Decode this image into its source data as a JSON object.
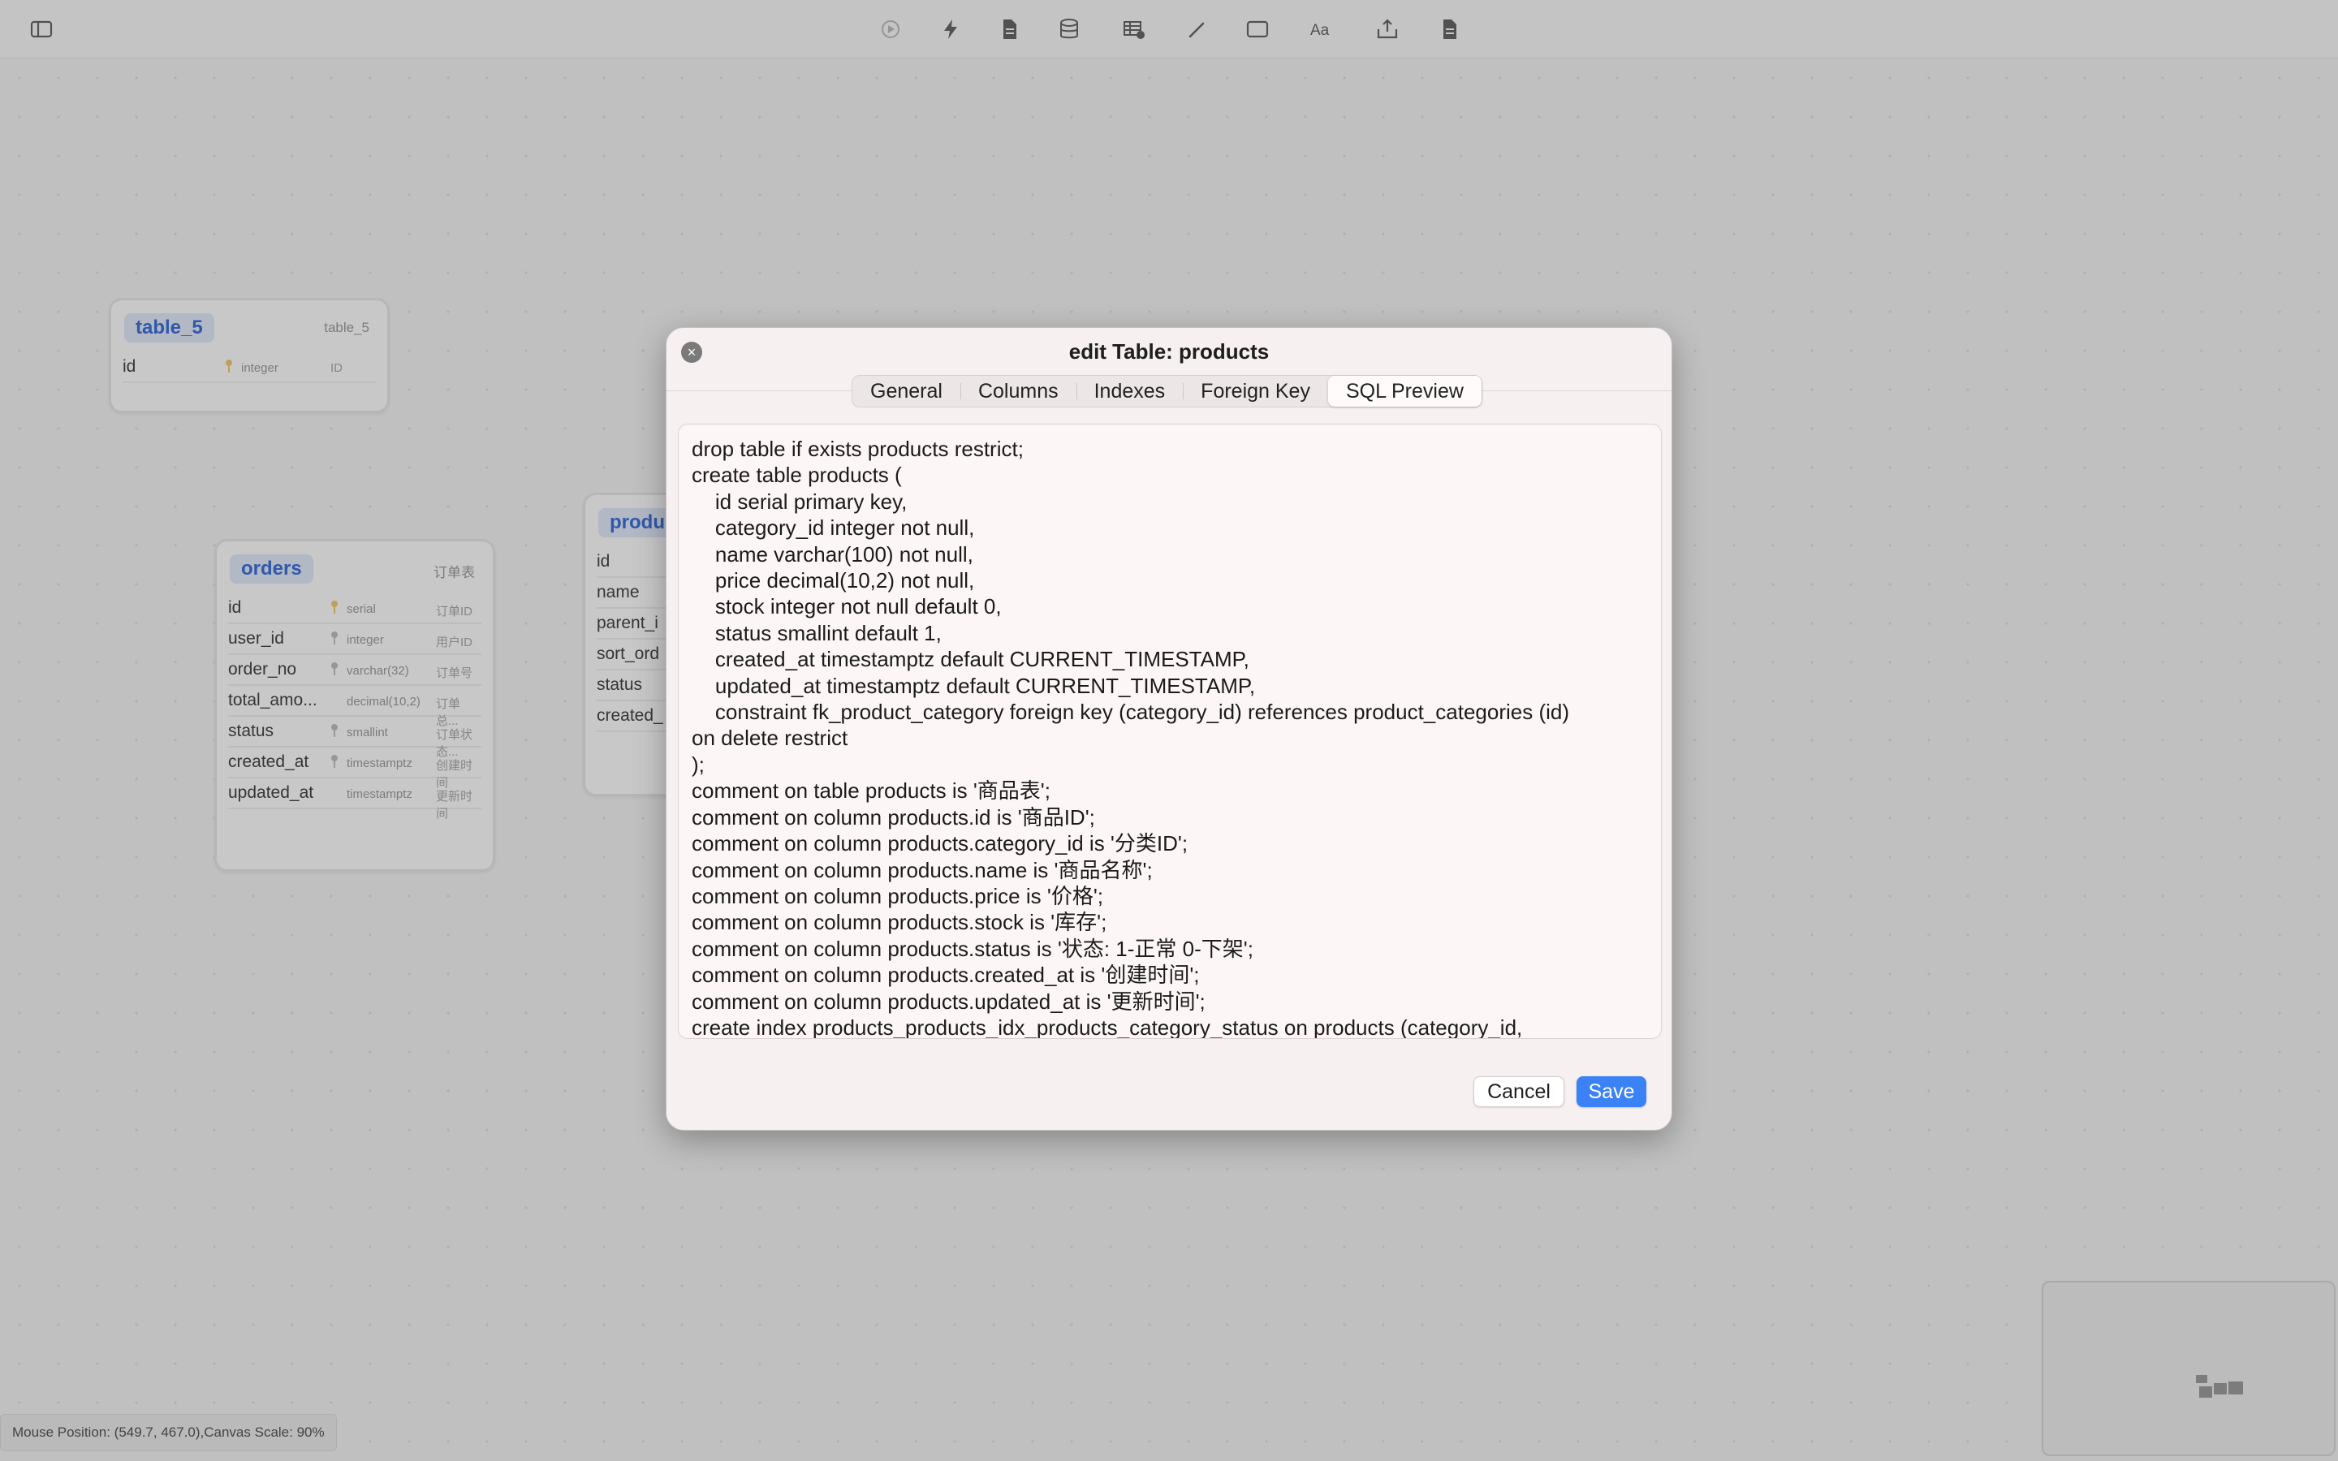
{
  "window": {
    "dialog_title": "edit Table: products"
  },
  "toolbar": {
    "icons": [
      "sidebar-toggle-icon",
      "play-icon",
      "lightning-icon",
      "document-icon",
      "database-icon",
      "table-add-icon",
      "pencil-icon",
      "rectangle-icon",
      "text-format-icon",
      "export-icon",
      "file-icon"
    ]
  },
  "tables": {
    "table_5": {
      "name": "table_5",
      "comment": "table_5",
      "columns": [
        {
          "name": "id",
          "type": "integer",
          "comment": "ID"
        }
      ]
    },
    "orders": {
      "name": "orders",
      "comment": "订单表",
      "columns": [
        {
          "name": "id",
          "type": "serial",
          "comment": "订单ID"
        },
        {
          "name": "user_id",
          "type": "integer",
          "comment": "用户ID"
        },
        {
          "name": "order_no",
          "type": "varchar(32)",
          "comment": "订单号"
        },
        {
          "name": "total_amo...",
          "type": "decimal(10,2)",
          "comment": "订单总..."
        },
        {
          "name": "status",
          "type": "smallint",
          "comment": "订单状态..."
        },
        {
          "name": "created_at",
          "type": "timestamptz",
          "comment": "创建时间"
        },
        {
          "name": "updated_at",
          "type": "timestamptz",
          "comment": "更新时间"
        }
      ]
    },
    "products": {
      "name": "produ",
      "columns": [
        {
          "name": "id"
        },
        {
          "name": "name"
        },
        {
          "name": "parent_i"
        },
        {
          "name": "sort_ord"
        },
        {
          "name": "status"
        },
        {
          "name": "created_"
        }
      ]
    }
  },
  "dialog": {
    "tabs": [
      {
        "label": "General"
      },
      {
        "label": "Columns"
      },
      {
        "label": "Indexes"
      },
      {
        "label": "Foreign Key"
      },
      {
        "label": "SQL Preview"
      }
    ],
    "active_tab": "SQL Preview",
    "sql": "drop table if exists products restrict;\ncreate table products (\n    id serial primary key,\n    category_id integer not null,\n    name varchar(100) not null,\n    price decimal(10,2) not null,\n    stock integer not null default 0,\n    status smallint default 1,\n    created_at timestamptz default CURRENT_TIMESTAMP,\n    updated_at timestamptz default CURRENT_TIMESTAMP,\n    constraint fk_product_category foreign key (category_id) references product_categories (id)\non delete restrict\n);\ncomment on table products is '商品表';\ncomment on column products.id is '商品ID';\ncomment on column products.category_id is '分类ID';\ncomment on column products.name is '商品名称';\ncomment on column products.price is '价格';\ncomment on column products.stock is '库存';\ncomment on column products.status is '状态: 1-正常 0-下架';\ncomment on column products.created_at is '创建时间';\ncomment on column products.updated_at is '更新时间';\ncreate index products_products_idx_products_category_status on products (category_id,",
    "cancel_label": "Cancel",
    "save_label": "Save"
  },
  "status_bar": {
    "text": "Mouse Position: (549.7, 467.0),Canvas Scale: 90%"
  },
  "colors": {
    "accent": "#3b82f6",
    "table_name_bg": "#dfe7f5",
    "table_name_fg": "#3c6fd6"
  }
}
